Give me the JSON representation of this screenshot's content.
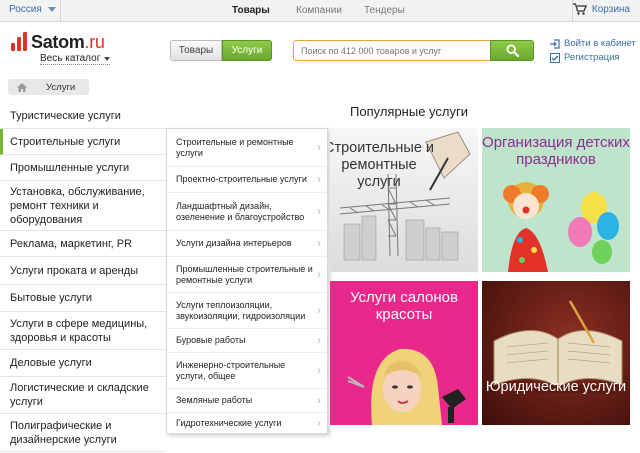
{
  "topbar": {
    "region": "Россия",
    "nav": [
      "Товары",
      "Компании",
      "Тендеры"
    ],
    "cart": "Корзина"
  },
  "logo": {
    "name": "Satom",
    "domain": ".ru",
    "catalog": "Весь каталог"
  },
  "toggle": {
    "goods": "Товары",
    "services": "Услуги"
  },
  "search": {
    "placeholder": "Поиск по 412 000 товаров и услуг"
  },
  "account": {
    "login": "Войти в кабинет",
    "register": "Регистрация"
  },
  "breadcrumb": {
    "current": "Услуги"
  },
  "sidebar": {
    "items": [
      "Туристические услуги",
      "Строительные услуги",
      "Промышленные услуги",
      "Установка, обслуживание, ремонт техники и оборудования",
      "Реклама, маркетинг, PR",
      "Услуги проката и аренды",
      "Бытовые услуги",
      "Услуги в сфере медицины, здоровья и красоты",
      "Деловые услуги",
      "Логистические и складские услуги",
      "Полиграфические и дизайнерские услуги"
    ]
  },
  "dropdown": {
    "items": [
      "Строительные и ремонтные услуги",
      "Проектно-строительные услуги",
      "Ландшафтный дизайн, озеленение и благоустройство",
      "Услуги дизайна интерьеров",
      "Промышленные строительные и ремонтные услуги",
      "Услуги теплоизоляции, звукоизоляции, гидроизоляции",
      "Буровые работы",
      "Инженерно-строительные услуги, общее",
      "Земляные работы",
      "Гидротехнические услуги"
    ]
  },
  "popular": {
    "title": "Популярные услуги",
    "tiles": [
      {
        "title": "Строительные и ремонтные услуги",
        "color": "#e9e9e9"
      },
      {
        "title": "Организация детских праздников",
        "color": "#bfe4cc"
      },
      {
        "title": "Услуги салонов красоты",
        "color": "#e8288a"
      },
      {
        "title": "Юридические услуги",
        "color": "#6b1e17"
      }
    ]
  },
  "colors": {
    "green": "#7bb33a",
    "red": "#e2322a",
    "link": "#3a6ea5",
    "search_border": "#e8a33b"
  }
}
